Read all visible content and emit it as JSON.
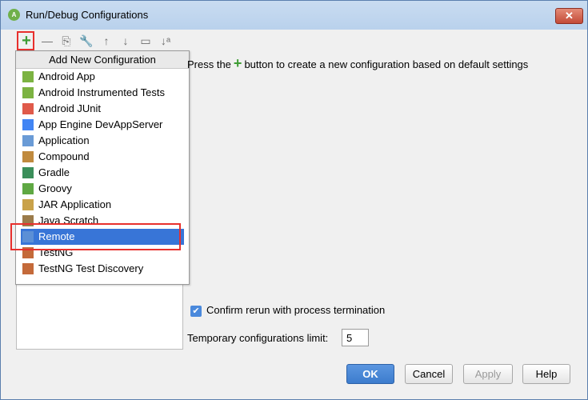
{
  "window": {
    "title": "Run/Debug Configurations",
    "close": "✕"
  },
  "toolbar": {
    "add": "+",
    "remove": "—",
    "copy": "⎘",
    "edit": "🔧",
    "up": "↑",
    "down": "↓",
    "folder": "▭",
    "sort": "↓ᵃ"
  },
  "popup": {
    "header": "Add New Configuration",
    "items": [
      {
        "label": "Android App",
        "icon": "android-app-icon",
        "color": "#7cb342"
      },
      {
        "label": "Android Instrumented Tests",
        "icon": "android-tests-icon",
        "color": "#7cb342"
      },
      {
        "label": "Android JUnit",
        "icon": "junit-icon",
        "color": "#e05a4a"
      },
      {
        "label": "App Engine DevAppServer",
        "icon": "app-engine-icon",
        "color": "#4285f4"
      },
      {
        "label": "Application",
        "icon": "application-icon",
        "color": "#6a9bd6"
      },
      {
        "label": "Compound",
        "icon": "compound-icon",
        "color": "#c08a3e"
      },
      {
        "label": "Gradle",
        "icon": "gradle-icon",
        "color": "#3b8f5a"
      },
      {
        "label": "Groovy",
        "icon": "groovy-icon",
        "color": "#5fa843"
      },
      {
        "label": "JAR Application",
        "icon": "jar-icon",
        "color": "#c9a24a"
      },
      {
        "label": "Java Scratch",
        "icon": "java-scratch-icon",
        "color": "#9b7b4a"
      },
      {
        "label": "Remote",
        "icon": "remote-icon",
        "color": "#5b8fd6"
      },
      {
        "label": "TestNG",
        "icon": "testng-icon",
        "color": "#c46a3a"
      },
      {
        "label": "TestNG Test Discovery",
        "icon": "testng-discovery-icon",
        "color": "#c46a3a"
      }
    ],
    "selected": "Remote"
  },
  "main": {
    "hint_prefix": "Press the",
    "hint_icon": "+",
    "hint_suffix": "button to create a new configuration based on default settings",
    "confirm_label": "Confirm rerun with process termination",
    "limit_label": "Temporary configurations limit:",
    "limit_value": "5"
  },
  "buttons": {
    "ok": "OK",
    "cancel": "Cancel",
    "apply": "Apply",
    "help": "Help"
  },
  "colors": {
    "accent": "#3875d7",
    "highlight": "#e8302d",
    "add": "#3e9c34"
  }
}
